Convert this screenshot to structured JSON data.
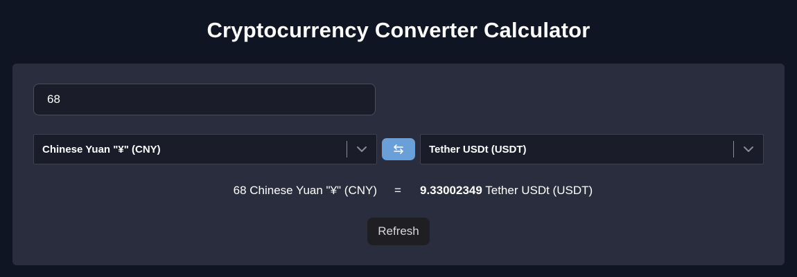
{
  "page": {
    "title": "Cryptocurrency Converter Calculator"
  },
  "converter": {
    "amount": "68",
    "from_currency": "Chinese Yuan \"¥\" (CNY)",
    "to_currency": "Tether USDt (USDT)",
    "result_from": "68 Chinese Yuan \"¥\" (CNY)",
    "equals": "=",
    "result_value": "9.33002349",
    "result_to_name": "Tether USDt (USDT)",
    "refresh_label": "Refresh"
  },
  "icons": {
    "swap": "swap-arrows-icon",
    "dropdown": "chevron-down-icon"
  },
  "colors": {
    "background": "#0f1523",
    "card": "#292d3d",
    "field": "#1a1d29",
    "accent": "#6a9fd8",
    "refresh_button": "#1f1f23"
  }
}
